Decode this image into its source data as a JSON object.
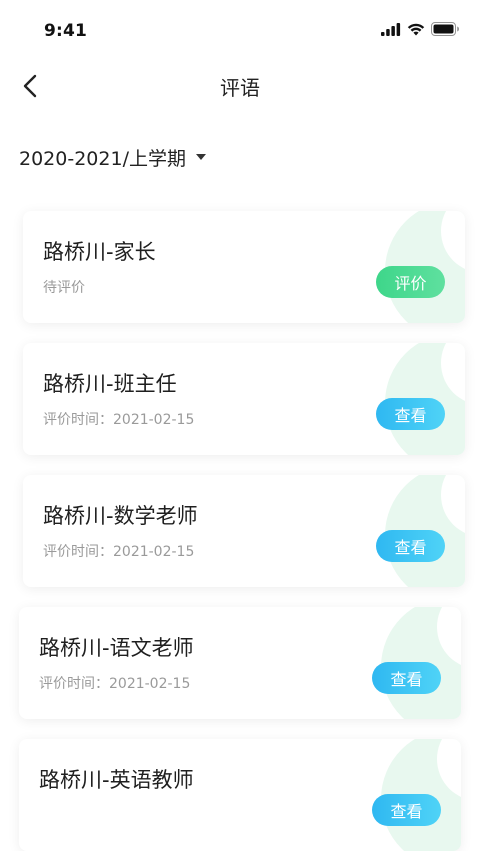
{
  "status_bar": {
    "time": "9:41"
  },
  "header": {
    "title": "评语"
  },
  "semester": {
    "label": "2020-2021/上学期"
  },
  "cards": [
    {
      "title": "路桥川-家长",
      "subtitle": "待评价",
      "button": "评价",
      "button_style": "evaluate"
    },
    {
      "title": "路桥川-班主任",
      "subtitle": "评价时间：2021-02-15",
      "button": "查看",
      "button_style": "view"
    },
    {
      "title": "路桥川-数学老师",
      "subtitle": "评价时间：2021-02-15",
      "button": "查看",
      "button_style": "view"
    },
    {
      "title": "路桥川-语文老师",
      "subtitle": "评价时间：2021-02-15",
      "button": "查看",
      "button_style": "view"
    },
    {
      "title": "路桥川-英语教师",
      "subtitle": "",
      "button": "查看",
      "button_style": "view"
    }
  ],
  "colors": {
    "evaluate_green": "#3ed68a",
    "view_blue": "#2fb8f1",
    "deco_green": "#e8f8ef"
  },
  "icons": {
    "back": "chevron-left-icon",
    "dropdown": "caret-down-icon",
    "signal": "signal-icon",
    "wifi": "wifi-icon",
    "battery": "battery-icon"
  }
}
